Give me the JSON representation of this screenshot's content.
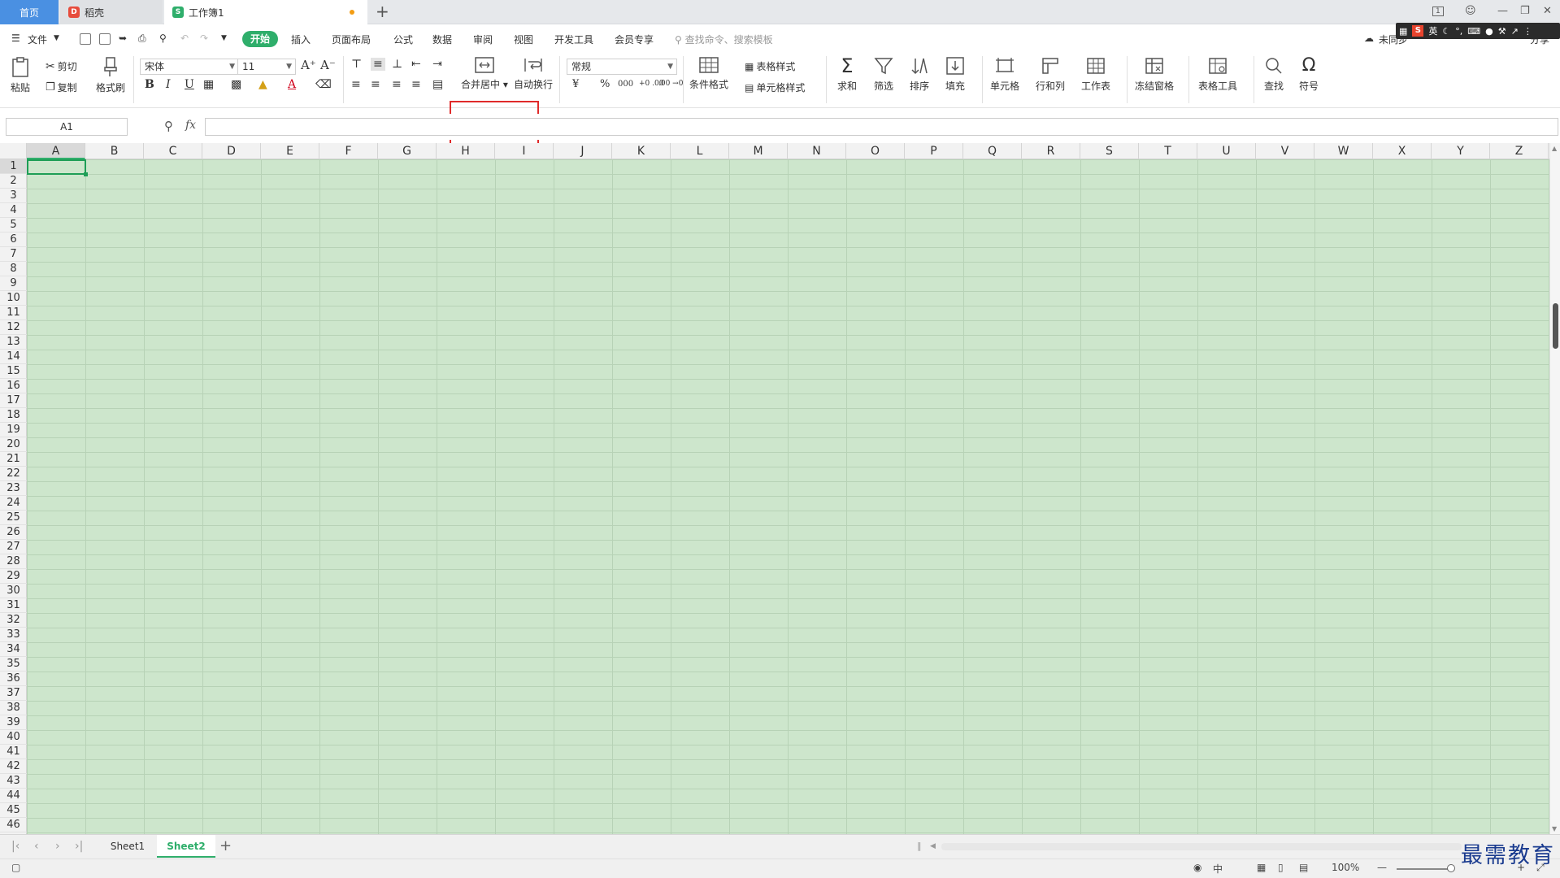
{
  "tabs": {
    "home": "首页",
    "daoke": "稻壳",
    "workbook": "工作簿1",
    "new_tab": "+"
  },
  "menu": {
    "file": "文件",
    "start": "开始",
    "items": [
      "插入",
      "页面布局",
      "公式",
      "数据",
      "审阅",
      "视图",
      "开发工具",
      "会员专享"
    ],
    "search_placeholder": "查找命令、搜索模板",
    "cloud": "未同步",
    "share": "分享"
  },
  "ribbon": {
    "paste": "粘贴",
    "cut": "剪切",
    "copy": "复制",
    "format_painter": "格式刷",
    "font_name": "宋体",
    "font_size": "11",
    "merge_center": "合并居中",
    "wrap_text": "自动换行",
    "number_format": "常规",
    "table_style": "表格样式",
    "conditional_format": "条件格式",
    "cell_style": "单元格样式",
    "sum": "求和",
    "filter": "筛选",
    "sort": "排序",
    "fill": "填充",
    "cell": "单元格",
    "row_col": "行和列",
    "worksheet": "工作表",
    "freeze": "冻结窗格",
    "table_tools": "表格工具",
    "find": "查找",
    "symbol": "符号",
    "currency": "¥",
    "percent": "%",
    "thousands": "000",
    "inc_decimal": "+0 .00",
    "dec_decimal": ".00 →0"
  },
  "formula_bar": {
    "cell_ref": "A1",
    "fx": "fx",
    "value": ""
  },
  "columns": [
    "A",
    "B",
    "C",
    "D",
    "E",
    "F",
    "G",
    "H",
    "I",
    "J",
    "K",
    "L",
    "M",
    "N",
    "O",
    "P",
    "Q",
    "R",
    "S",
    "T",
    "U",
    "V",
    "W",
    "X",
    "Y",
    "Z"
  ],
  "rows": [
    "1",
    "2",
    "3",
    "4",
    "5",
    "6",
    "7",
    "8",
    "9",
    "10",
    "11",
    "12",
    "13",
    "14",
    "15",
    "16",
    "17",
    "18",
    "19",
    "20",
    "21",
    "22",
    "23",
    "24",
    "25",
    "26",
    "27",
    "28",
    "29",
    "30",
    "31",
    "32",
    "33",
    "34",
    "35",
    "36",
    "37",
    "38",
    "39",
    "40",
    "41",
    "42",
    "43",
    "44",
    "45",
    "46"
  ],
  "sheets": [
    "Sheet1",
    "Sheet2"
  ],
  "active_sheet": "Sheet2",
  "status": {
    "ime": "中",
    "zoom": "100%"
  },
  "ime_bar": {
    "lang": "英"
  },
  "watermark": "最需教育",
  "colors": {
    "accent": "#2fae6b",
    "grid_bg": "#cde6cc",
    "highlight": "#e02a2a",
    "home_tab": "#4a90e2"
  }
}
